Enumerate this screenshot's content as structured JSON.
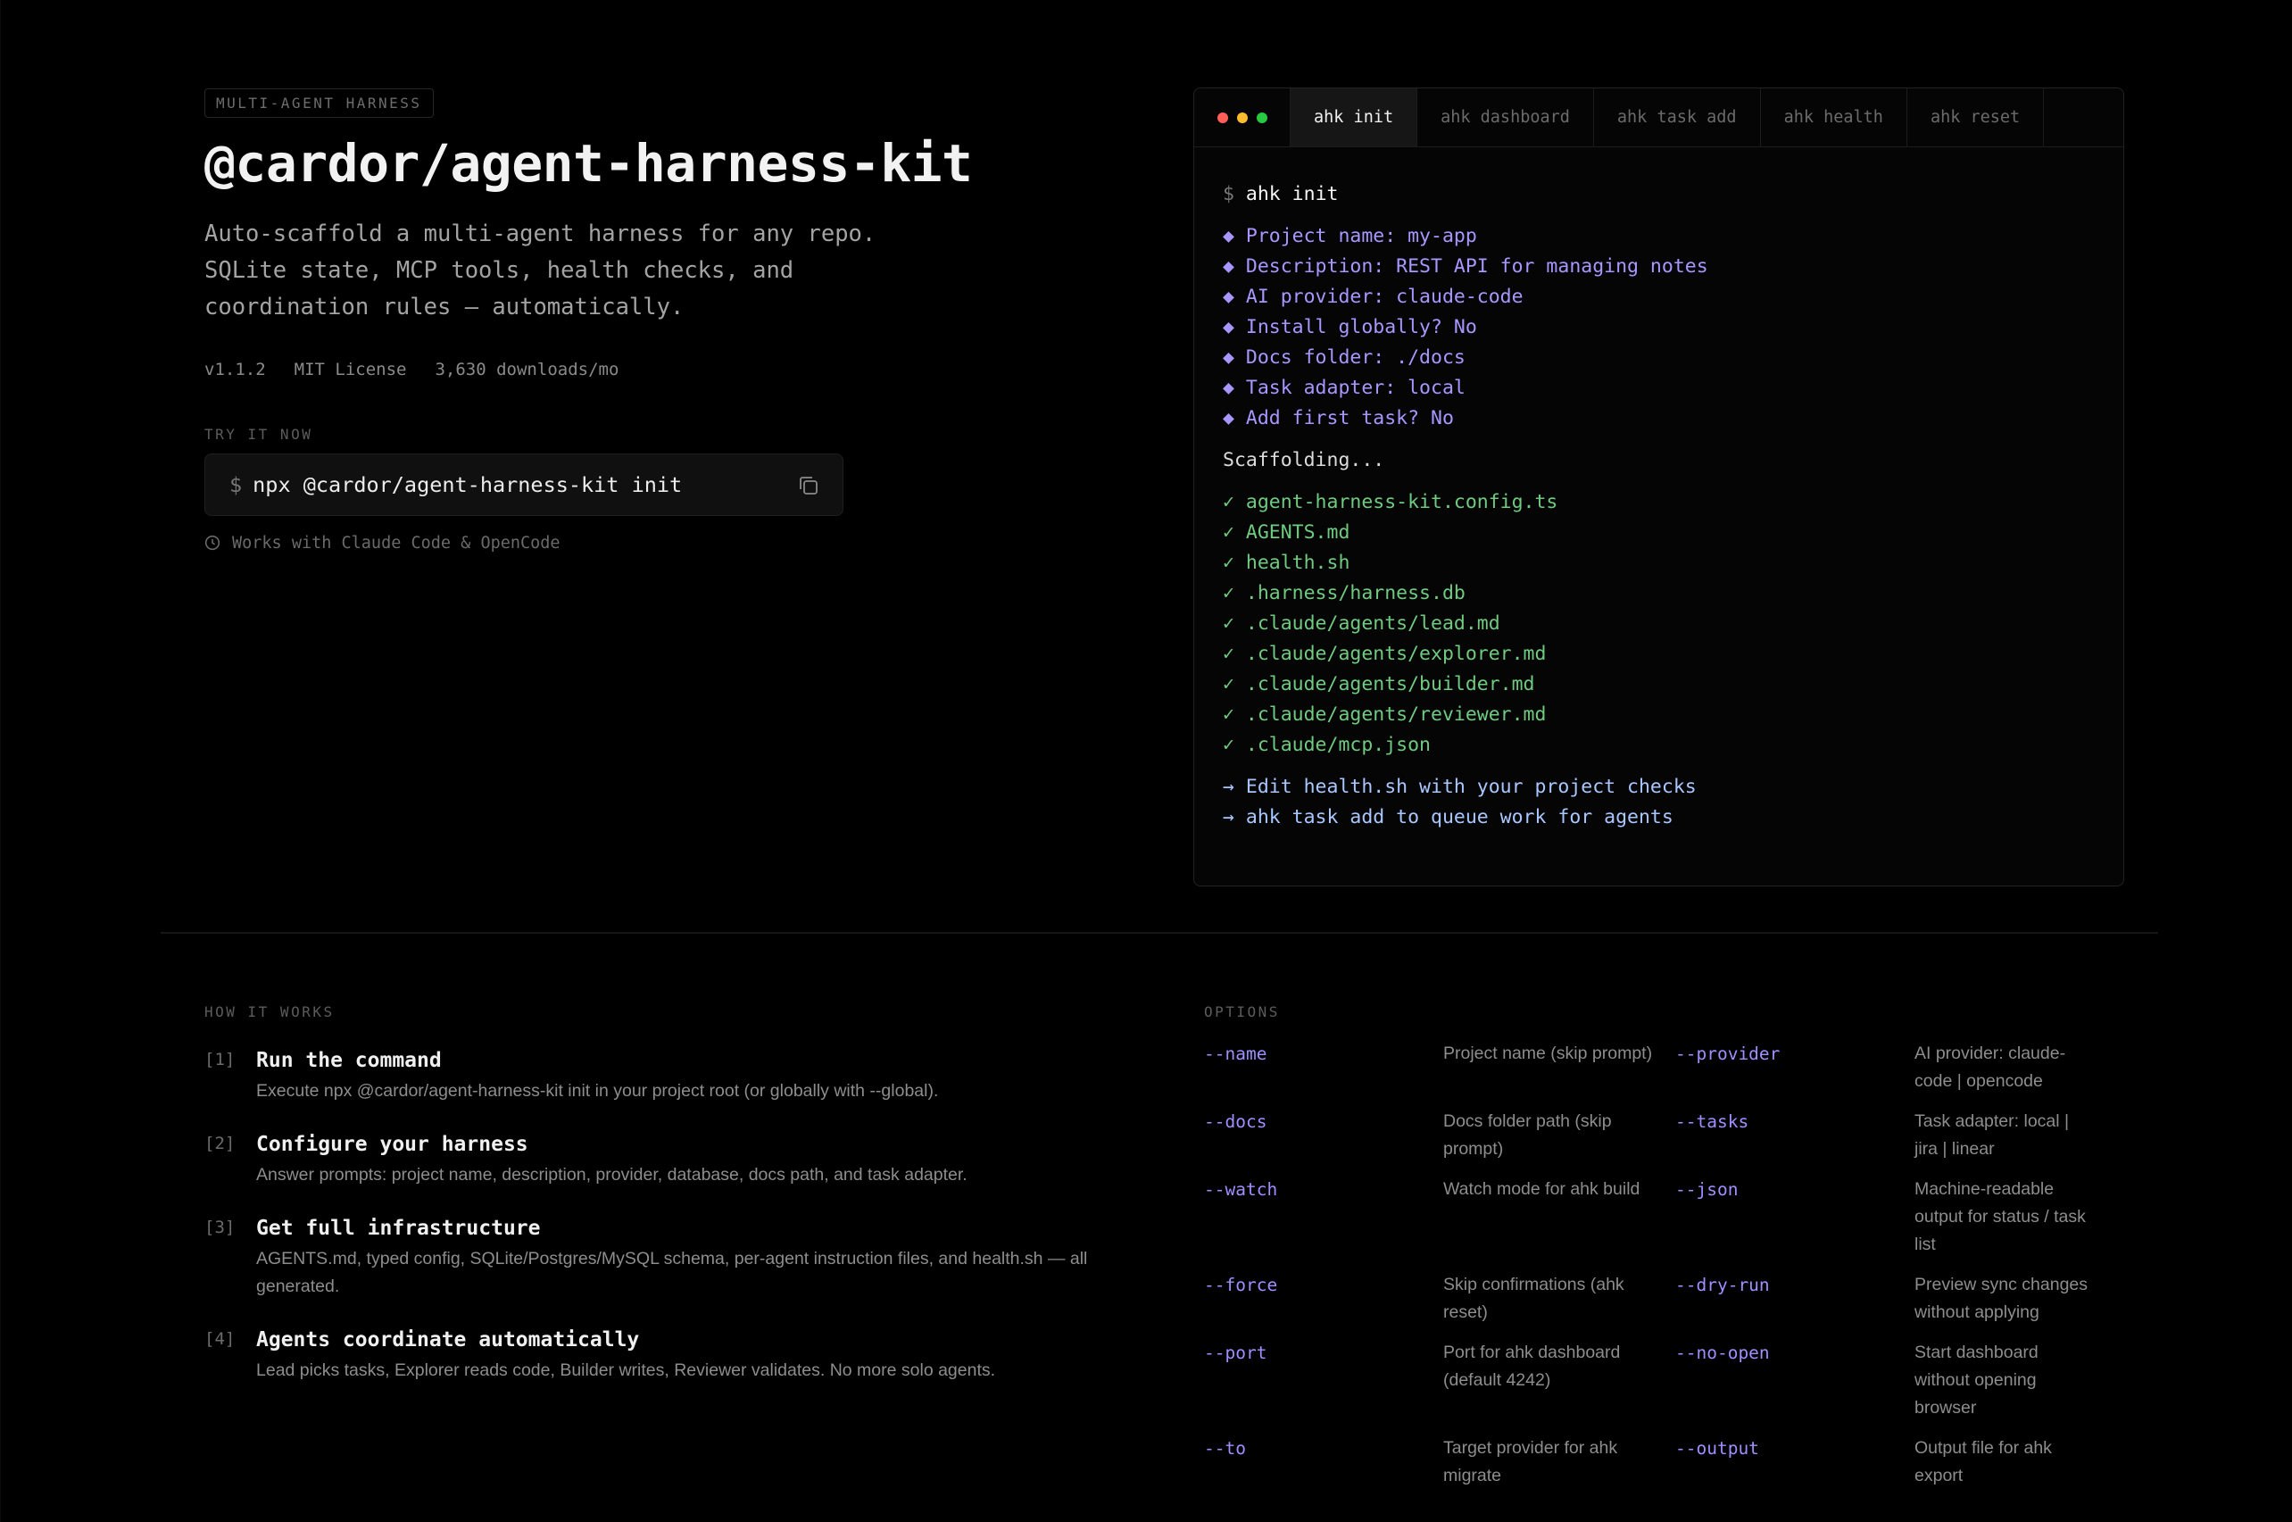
{
  "hero": {
    "badge": "MULTI-AGENT HARNESS",
    "title": "@cardor/agent-harness-kit",
    "description": "Auto-scaffold a multi-agent harness for any repo. SQLite state, MCP tools, health checks, and coordination rules — automatically.",
    "meta": {
      "version": "v1.1.2",
      "license": "MIT License",
      "downloads": "3,630 downloads/mo"
    },
    "try_label": "TRY IT NOW",
    "command_prompt": "$",
    "command": "npx @cardor/agent-harness-kit init",
    "works_with": "Works with Claude Code & OpenCode",
    "icons": {
      "copy": "copy-icon",
      "clock": "clock-icon"
    }
  },
  "terminal": {
    "window_dots": [
      "#ff5f57",
      "#febc2e",
      "#28c840"
    ],
    "tabs": [
      "ahk init",
      "ahk dashboard",
      "ahk task add",
      "ahk health",
      "ahk reset"
    ],
    "active_tab": "ahk init",
    "prompt": "$",
    "command": "ahk init",
    "answers": [
      "◆ Project name: my-app",
      "◆ Description: REST API for managing notes",
      "◆ AI provider: claude-code",
      "◆ Install globally? No",
      "◆ Docs folder: ./docs",
      "◆ Task adapter: local",
      "◆ Add first task? No"
    ],
    "status": "Scaffolding...",
    "created": [
      "✓ agent-harness-kit.config.ts",
      "✓ AGENTS.md",
      "✓ health.sh",
      "✓ .harness/harness.db",
      "✓ .claude/agents/lead.md",
      "✓ .claude/agents/explorer.md",
      "✓ .claude/agents/builder.md",
      "✓ .claude/agents/reviewer.md",
      "✓ .claude/mcp.json"
    ],
    "next_steps": [
      "→ Edit health.sh with your project checks",
      "→ ahk task add to queue work for agents"
    ],
    "colors": {
      "answers": "#a996ff",
      "created": "#6ecb7f",
      "next_steps": "#a9c7ff"
    }
  },
  "how": {
    "label": "HOW IT WORKS",
    "steps": [
      {
        "num": "[1]",
        "title": "Run the command",
        "desc": "Execute npx @cardor/agent-harness-kit init in your project root (or globally with --global)."
      },
      {
        "num": "[2]",
        "title": "Configure your harness",
        "desc": "Answer prompts: project name, description, provider, database, docs path, and task adapter."
      },
      {
        "num": "[3]",
        "title": "Get full infrastructure",
        "desc": "AGENTS.md, typed config, SQLite/Postgres/MySQL schema, per-agent instruction files, and health.sh — all generated."
      },
      {
        "num": "[4]",
        "title": "Agents coordinate automatically",
        "desc": "Lead picks tasks, Explorer reads code, Builder writes, Reviewer validates. No more solo agents."
      }
    ]
  },
  "options": {
    "label": "OPTIONS",
    "rows": [
      {
        "flag1": "--name",
        "desc1": "Project name (skip prompt)",
        "flag2": "--provider",
        "desc2": "AI provider: claude-code | opencode"
      },
      {
        "flag1": "--docs",
        "desc1": "Docs folder path (skip prompt)",
        "flag2": "--tasks",
        "desc2": "Task adapter: local | jira | linear"
      },
      {
        "flag1": "--watch",
        "desc1": "Watch mode for ahk build",
        "flag2": "--json",
        "desc2": "Machine-readable output for status / task list"
      },
      {
        "flag1": "--force",
        "desc1": "Skip confirmations (ahk reset)",
        "flag2": "--dry-run",
        "desc2": "Preview sync changes without applying"
      },
      {
        "flag1": "--port",
        "desc1": "Port for ahk dashboard (default 4242)",
        "flag2": "--no-open",
        "desc2": "Start dashboard without opening browser"
      },
      {
        "flag1": "--to",
        "desc1": "Target provider for ahk migrate",
        "flag2": "--output",
        "desc2": "Output file for ahk export"
      }
    ]
  }
}
